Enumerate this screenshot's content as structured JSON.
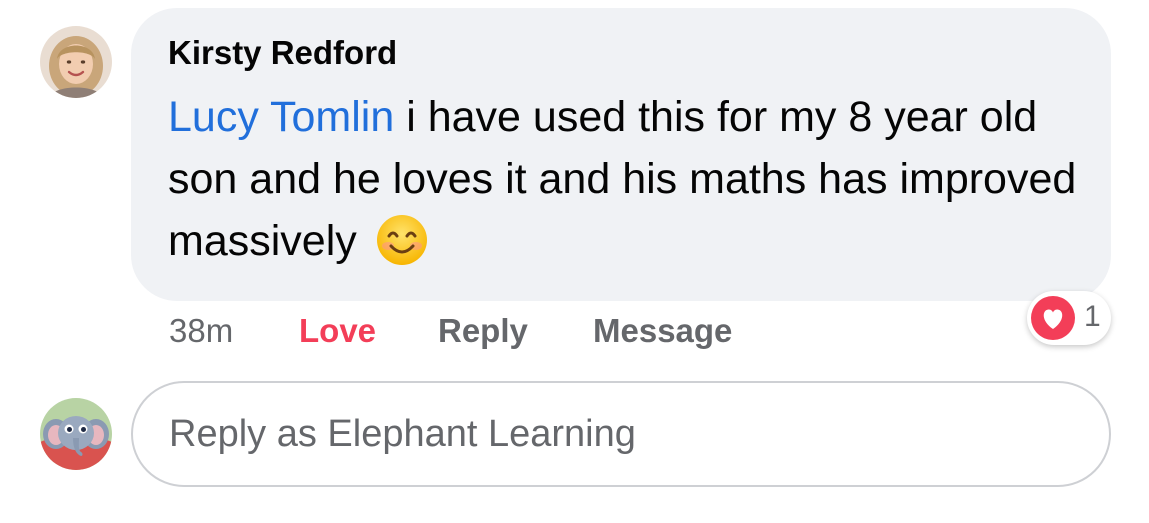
{
  "comment": {
    "author": "Kirsty Redford",
    "mention": "Lucy Tomlin",
    "text": " i have used this for my 8 year old son and he loves it and his maths has improved massively",
    "emoji": "smiling-face-icon"
  },
  "actions": {
    "time": "38m",
    "love_label": "Love",
    "reply_label": "Reply",
    "message_label": "Message"
  },
  "reactions": {
    "icon": "heart-icon",
    "count": "1"
  },
  "reply_box": {
    "placeholder": "Reply as Elephant Learning",
    "value": ""
  },
  "colors": {
    "bubble_bg": "#f0f2f5",
    "mention": "#216fdb",
    "love": "#f33e58",
    "secondary_text": "#65676b",
    "primary_text": "#050505"
  }
}
